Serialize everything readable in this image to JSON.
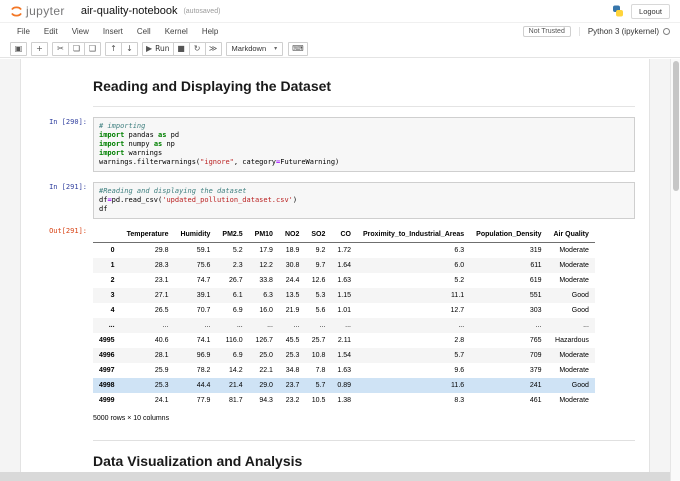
{
  "header": {
    "logo": "jupyter",
    "title": "air-quality-notebook",
    "autosaved": "(autosaved)",
    "logout": "Logout"
  },
  "menu": {
    "items": [
      "File",
      "Edit",
      "View",
      "Insert",
      "Cell",
      "Kernel",
      "Help"
    ],
    "not_trusted": "Not Trusted",
    "kernel": "Python 3 (ipykernel)"
  },
  "toolbar": {
    "groups": [
      [
        {
          "name": "save-icon",
          "glyph": "▣"
        }
      ],
      [
        {
          "name": "add-cell-icon",
          "glyph": "+"
        }
      ],
      [
        {
          "name": "cut-cell-icon",
          "glyph": "✂"
        },
        {
          "name": "copy-cell-icon",
          "glyph": "❏"
        },
        {
          "name": "paste-cell-icon",
          "glyph": "❑"
        }
      ],
      [
        {
          "name": "move-cell-up-icon",
          "glyph": "↑"
        },
        {
          "name": "move-cell-down-icon",
          "glyph": "↓"
        }
      ],
      [
        {
          "name": "run-button",
          "glyph": "▶",
          "label": "Run"
        },
        {
          "name": "stop-icon",
          "glyph": "■"
        },
        {
          "name": "restart-kernel-icon",
          "glyph": "↻"
        },
        {
          "name": "restart-run-all-icon",
          "glyph": "≫"
        }
      ]
    ],
    "cell_type": "Markdown",
    "caret": "▾",
    "command_palette_glyph": "⌨"
  },
  "notebook": {
    "heading1": "Reading and Displaying the Dataset",
    "heading2": "Data Visualization and Analysis",
    "out_prompt": "Out[291]:",
    "cells": [
      {
        "prompt": "In [290]:",
        "lines": [
          [
            {
              "t": "# importing",
              "c": "com"
            }
          ],
          [
            {
              "t": "import",
              "c": "kw"
            },
            {
              "t": " pandas ",
              "c": "pl"
            },
            {
              "t": "as",
              "c": "kw"
            },
            {
              "t": " pd",
              "c": "pl"
            }
          ],
          [
            {
              "t": "import",
              "c": "kw"
            },
            {
              "t": " numpy ",
              "c": "pl"
            },
            {
              "t": "as",
              "c": "kw"
            },
            {
              "t": " np",
              "c": "pl"
            }
          ],
          [
            {
              "t": "import",
              "c": "kw"
            },
            {
              "t": " warnings",
              "c": "pl"
            }
          ],
          [
            {
              "t": "warnings.filterwarnings(",
              "c": "pl"
            },
            {
              "t": "\"ignore\"",
              "c": "str"
            },
            {
              "t": ", category",
              "c": "pl"
            },
            {
              "t": "=",
              "c": "op"
            },
            {
              "t": "FutureWarning)",
              "c": "pl"
            }
          ]
        ]
      },
      {
        "prompt": "In [291]:",
        "lines": [
          [
            {
              "t": "#Reading and displaying the dataset",
              "c": "com"
            }
          ],
          [
            {
              "t": "df",
              "c": "pl"
            },
            {
              "t": "=",
              "c": "op"
            },
            {
              "t": "pd.read_csv(",
              "c": "pl"
            },
            {
              "t": "'updated_pollution_dataset.csv'",
              "c": "str"
            },
            {
              "t": ")",
              "c": "pl"
            }
          ],
          [
            {
              "t": "df",
              "c": "pl"
            }
          ]
        ]
      }
    ],
    "table": {
      "columns": [
        "",
        "Temperature",
        "Humidity",
        "PM2.5",
        "PM10",
        "NO2",
        "SO2",
        "CO",
        "Proximity_to_Industrial_Areas",
        "Population_Density",
        "Air Quality"
      ],
      "rows": [
        {
          "index": "0",
          "cells": [
            "29.8",
            "59.1",
            "5.2",
            "17.9",
            "18.9",
            "9.2",
            "1.72",
            "6.3",
            "319",
            "Moderate"
          ]
        },
        {
          "index": "1",
          "cells": [
            "28.3",
            "75.6",
            "2.3",
            "12.2",
            "30.8",
            "9.7",
            "1.64",
            "6.0",
            "611",
            "Moderate"
          ]
        },
        {
          "index": "2",
          "cells": [
            "23.1",
            "74.7",
            "26.7",
            "33.8",
            "24.4",
            "12.6",
            "1.63",
            "5.2",
            "619",
            "Moderate"
          ]
        },
        {
          "index": "3",
          "cells": [
            "27.1",
            "39.1",
            "6.1",
            "6.3",
            "13.5",
            "5.3",
            "1.15",
            "11.1",
            "551",
            "Good"
          ]
        },
        {
          "index": "4",
          "cells": [
            "26.5",
            "70.7",
            "6.9",
            "16.0",
            "21.9",
            "5.6",
            "1.01",
            "12.7",
            "303",
            "Good"
          ]
        },
        {
          "index": "...",
          "cells": [
            "...",
            "...",
            "...",
            "...",
            "...",
            "...",
            "...",
            "...",
            "...",
            "..."
          ]
        },
        {
          "index": "4995",
          "cells": [
            "40.6",
            "74.1",
            "116.0",
            "126.7",
            "45.5",
            "25.7",
            "2.11",
            "2.8",
            "765",
            "Hazardous"
          ]
        },
        {
          "index": "4996",
          "cells": [
            "28.1",
            "96.9",
            "6.9",
            "25.0",
            "25.3",
            "10.8",
            "1.54",
            "5.7",
            "709",
            "Moderate"
          ]
        },
        {
          "index": "4997",
          "cells": [
            "25.9",
            "78.2",
            "14.2",
            "22.1",
            "34.8",
            "7.8",
            "1.63",
            "9.6",
            "379",
            "Moderate"
          ]
        },
        {
          "index": "4998",
          "cells": [
            "25.3",
            "44.4",
            "21.4",
            "29.0",
            "23.7",
            "5.7",
            "0.89",
            "11.6",
            "241",
            "Good"
          ]
        },
        {
          "index": "4999",
          "cells": [
            "24.1",
            "77.9",
            "81.7",
            "94.3",
            "23.2",
            "10.5",
            "1.38",
            "8.3",
            "461",
            "Moderate"
          ]
        }
      ],
      "highlight_index": "4998"
    },
    "table_footer": "5000 rows × 10 columns"
  },
  "colors": {
    "prompt_in": "#303F9F",
    "prompt_out": "#D84315",
    "row_highlight": "#cfe3f5",
    "jupyter_orange": "#f37726",
    "python_blue": "#3776ab",
    "python_yellow": "#ffd43b"
  }
}
